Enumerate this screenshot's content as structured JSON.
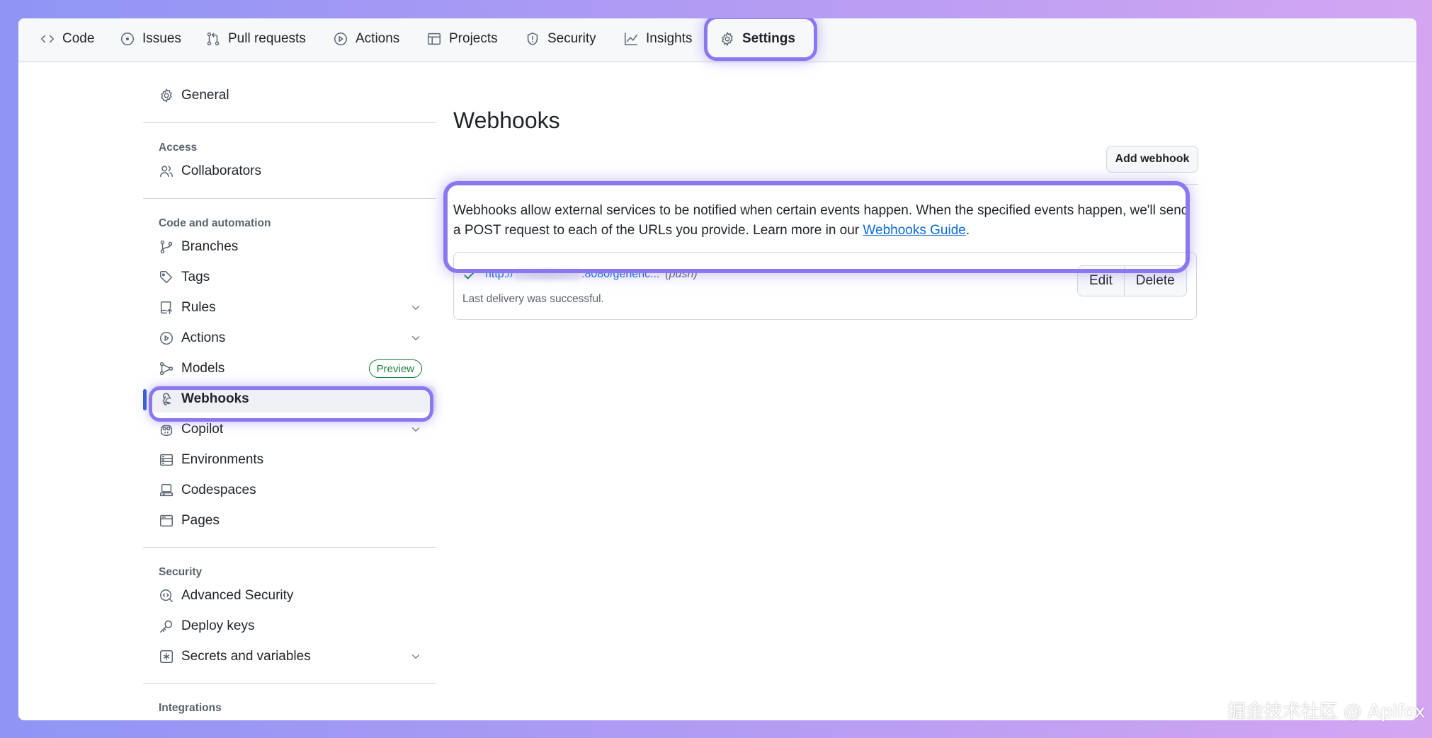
{
  "nav": {
    "tabs": [
      {
        "label": "Code",
        "icon": "code-icon"
      },
      {
        "label": "Issues",
        "icon": "issue-icon"
      },
      {
        "label": "Pull requests",
        "icon": "pull-request-icon"
      },
      {
        "label": "Actions",
        "icon": "play-icon"
      },
      {
        "label": "Projects",
        "icon": "table-icon"
      },
      {
        "label": "Security",
        "icon": "shield-icon"
      },
      {
        "label": "Insights",
        "icon": "graph-icon"
      },
      {
        "label": "Settings",
        "icon": "gear-icon"
      }
    ],
    "active": "Settings"
  },
  "sidebar": {
    "general": "General",
    "access_heading": "Access",
    "collaborators": "Collaborators",
    "code_heading": "Code and automation",
    "branches": "Branches",
    "tags": "Tags",
    "rules": "Rules",
    "actions": "Actions",
    "models": "Models",
    "preview_badge": "Preview",
    "webhooks": "Webhooks",
    "copilot": "Copilot",
    "environments": "Environments",
    "codespaces": "Codespaces",
    "pages": "Pages",
    "security_heading": "Security",
    "advanced_security": "Advanced Security",
    "deploy_keys": "Deploy keys",
    "secrets": "Secrets and variables",
    "integrations_heading": "Integrations",
    "selected": "Webhooks"
  },
  "main": {
    "title": "Webhooks",
    "add_button": "Add webhook",
    "description": "Webhooks allow external services to be notified when certain events happen. When the specified events happen, we'll send a POST request to each of the URLs you provide. Learn more in our",
    "guide_link": "Webhooks Guide",
    "period": ".",
    "hook": {
      "url_prefix": "http://",
      "url_suffix": ":8080/generic...",
      "event": "(push)",
      "status": "Last delivery was successful.",
      "edit": "Edit",
      "delete": "Delete"
    }
  },
  "colors": {
    "accent_highlight": "#8b78ef",
    "link": "#0969da",
    "success": "#1a7f37"
  },
  "watermark": "掘金技术社区 @ Apifox"
}
